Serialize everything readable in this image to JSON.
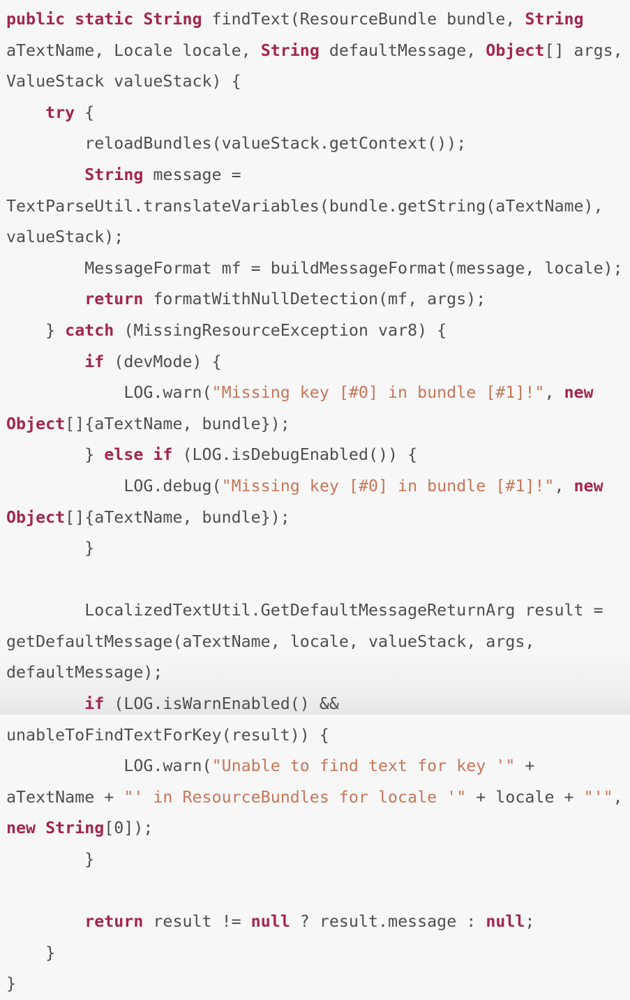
{
  "viewer": {
    "name": "code-snippet-viewer",
    "language": "java",
    "background_color": "#f7f7f7",
    "plain_color": "#4e4e50",
    "keyword_color": "#a3264e",
    "string_color": "#c8765a"
  },
  "code": {
    "lines": [
      {
        "indent": 0,
        "tokens": [
          {
            "t": "key",
            "v": "public static String"
          },
          {
            "t": "plain",
            "v": " findText(ResourceBundle bundle, "
          },
          {
            "t": "key",
            "v": "String"
          },
          {
            "t": "plain",
            "v": " aTextName, Locale locale, "
          },
          {
            "t": "key",
            "v": "String"
          },
          {
            "t": "plain",
            "v": " defaultMessage, "
          },
          {
            "t": "key",
            "v": "Object"
          },
          {
            "t": "plain",
            "v": "[] args, ValueStack valueStack) {"
          }
        ]
      },
      {
        "indent": 1,
        "tokens": [
          {
            "t": "key",
            "v": "try"
          },
          {
            "t": "plain",
            "v": " {"
          }
        ]
      },
      {
        "indent": 2,
        "tokens": [
          {
            "t": "plain",
            "v": "reloadBundles(valueStack.getContext());"
          }
        ]
      },
      {
        "indent": 2,
        "tokens": [
          {
            "t": "key",
            "v": "String"
          },
          {
            "t": "plain",
            "v": " message = TextParseUtil.translateVariables(bundle.getString(aTextName), valueStack);"
          }
        ]
      },
      {
        "indent": 2,
        "tokens": [
          {
            "t": "plain",
            "v": "MessageFormat mf = buildMessageFormat(message, locale);"
          }
        ]
      },
      {
        "indent": 2,
        "tokens": [
          {
            "t": "key",
            "v": "return"
          },
          {
            "t": "plain",
            "v": " formatWithNullDetection(mf, args);"
          }
        ]
      },
      {
        "indent": 1,
        "tokens": [
          {
            "t": "plain",
            "v": "} "
          },
          {
            "t": "key",
            "v": "catch"
          },
          {
            "t": "plain",
            "v": " (MissingResourceException var8) {"
          }
        ]
      },
      {
        "indent": 2,
        "tokens": [
          {
            "t": "key",
            "v": "if"
          },
          {
            "t": "plain",
            "v": " (devMode) {"
          }
        ]
      },
      {
        "indent": 3,
        "tokens": [
          {
            "t": "plain",
            "v": "LOG.warn("
          },
          {
            "t": "string",
            "v": "\"Missing key [#0] in bundle [#1]!\""
          },
          {
            "t": "plain",
            "v": ", "
          },
          {
            "t": "key",
            "v": "new Object"
          },
          {
            "t": "plain",
            "v": "[]{aTextName, bundle});"
          }
        ]
      },
      {
        "indent": 2,
        "tokens": [
          {
            "t": "plain",
            "v": "} "
          },
          {
            "t": "key",
            "v": "else if"
          },
          {
            "t": "plain",
            "v": " (LOG.isDebugEnabled()) {"
          }
        ]
      },
      {
        "indent": 3,
        "tokens": [
          {
            "t": "plain",
            "v": "LOG.debug("
          },
          {
            "t": "string",
            "v": "\"Missing key [#0] in bundle [#1]!\""
          },
          {
            "t": "plain",
            "v": ", "
          },
          {
            "t": "key",
            "v": "new Object"
          },
          {
            "t": "plain",
            "v": "[]{aTextName, bundle});"
          }
        ]
      },
      {
        "indent": 2,
        "tokens": [
          {
            "t": "plain",
            "v": "}"
          }
        ]
      },
      {
        "indent": 0,
        "blank": true,
        "tokens": []
      },
      {
        "indent": 2,
        "tokens": [
          {
            "t": "plain",
            "v": "LocalizedTextUtil.GetDefaultMessageReturnArg result = getDefaultMessage(aTextName, locale, valueStack, args, defaultMessage);"
          }
        ]
      },
      {
        "indent": 2,
        "tokens": [
          {
            "t": "key",
            "v": "if"
          },
          {
            "t": "plain",
            "v": " (LOG.isWarnEnabled() && unableToFindTextForKey(result)) {"
          }
        ]
      },
      {
        "indent": 3,
        "tokens": [
          {
            "t": "plain",
            "v": "LOG.warn("
          },
          {
            "t": "string",
            "v": "\"Unable to find text for key '\""
          },
          {
            "t": "plain",
            "v": " + aTextName + "
          },
          {
            "t": "string",
            "v": "\"' in ResourceBundles for locale '\""
          },
          {
            "t": "plain",
            "v": " + locale + "
          },
          {
            "t": "string",
            "v": "\"'\""
          },
          {
            "t": "plain",
            "v": ", "
          },
          {
            "t": "key",
            "v": "new String"
          },
          {
            "t": "plain",
            "v": "[0]);"
          }
        ]
      },
      {
        "indent": 2,
        "tokens": [
          {
            "t": "plain",
            "v": "}"
          }
        ]
      },
      {
        "indent": 0,
        "blank": true,
        "tokens": []
      },
      {
        "indent": 2,
        "tokens": [
          {
            "t": "key",
            "v": "return"
          },
          {
            "t": "plain",
            "v": " result != "
          },
          {
            "t": "key",
            "v": "null"
          },
          {
            "t": "plain",
            "v": " ? result.message : "
          },
          {
            "t": "key",
            "v": "null"
          },
          {
            "t": "plain",
            "v": ";"
          }
        ]
      },
      {
        "indent": 1,
        "tokens": [
          {
            "t": "plain",
            "v": "}"
          }
        ]
      },
      {
        "indent": 0,
        "tokens": [
          {
            "t": "plain",
            "v": "}"
          }
        ]
      }
    ]
  }
}
